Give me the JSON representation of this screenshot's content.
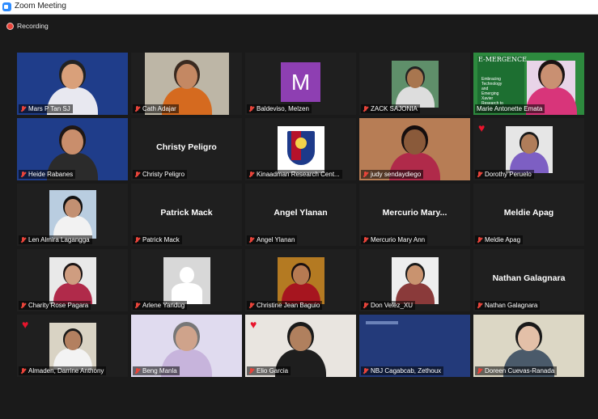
{
  "window": {
    "title": "Zoom Meeting"
  },
  "recording": {
    "label": "Recording"
  },
  "colors": {
    "background": "#1a1a1a",
    "active_speaker": "#e0e05a",
    "muted_icon": "#e8443a",
    "recording_dot": "#e8443a",
    "reaction_heart": "#e8142c"
  },
  "participants": [
    {
      "name": "Mars P Tan SJ",
      "video": true,
      "muted": true
    },
    {
      "name": "Cath Adajar",
      "video": true,
      "muted": true
    },
    {
      "name": "Baldeviso, Melzen",
      "video": false,
      "avatar_letter": "M",
      "muted": true
    },
    {
      "name": "ZACK SAJONIA",
      "video": true,
      "muted": true
    },
    {
      "name": "Marie Antonette Emata",
      "video": true,
      "muted": false,
      "active_speaker": true,
      "slide_title": "E-MERGENCE",
      "slide_text": "Embracing Technology and Emerging Xavier Research to"
    },
    {
      "name": "Heide Rabanes",
      "video": true,
      "muted": true
    },
    {
      "name": "Christy Peligro",
      "video": false,
      "display_name": "Christy Peligro",
      "muted": true
    },
    {
      "name": "Kinaadman Research Cent...",
      "video": true,
      "muted": true
    },
    {
      "name": "judy sendaydiego",
      "video": true,
      "muted": true
    },
    {
      "name": "Dorothy Peruelo",
      "video": true,
      "muted": true,
      "reaction": "heart"
    },
    {
      "name": "Len Almira Lagangga",
      "video": true,
      "muted": true
    },
    {
      "name": "Patrick Mack",
      "video": false,
      "display_name": "Patrick Mack",
      "muted": true
    },
    {
      "name": "Angel Ylanan",
      "video": false,
      "display_name": "Angel Ylanan",
      "muted": true
    },
    {
      "name": "Mercurio Mary Ann",
      "video": false,
      "display_name": "Mercurio  Mary...",
      "muted": true
    },
    {
      "name": "Meldie Apag",
      "video": false,
      "display_name": "Meldie Apag",
      "muted": true
    },
    {
      "name": "Charity Rose Pagara",
      "video": true,
      "muted": true
    },
    {
      "name": "Arlene Yandug",
      "video": true,
      "muted": true
    },
    {
      "name": "Christine Jean Baguio",
      "video": true,
      "muted": true
    },
    {
      "name": "Don Velez_XU",
      "video": true,
      "muted": true
    },
    {
      "name": "Nathan Galagnara",
      "video": false,
      "display_name": "Nathan Galagnara",
      "muted": true
    },
    {
      "name": "Almaden, Darrine Anthony",
      "video": true,
      "muted": true,
      "reaction": "heart"
    },
    {
      "name": "Beng Manla",
      "video": true,
      "muted": true
    },
    {
      "name": "Elio Garcia",
      "video": true,
      "muted": true,
      "reaction": "heart"
    },
    {
      "name": "NBJ Cagabcab, Zethoux",
      "video": true,
      "muted": true
    },
    {
      "name": "Doreen Cuevas-Ranada",
      "video": true,
      "muted": true
    }
  ]
}
